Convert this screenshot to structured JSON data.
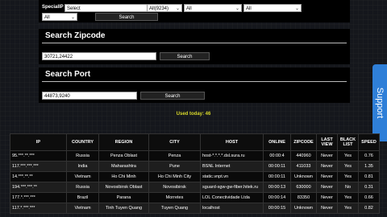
{
  "filters": {
    "specialip_label": "SpecialIP",
    "select_value": "Select",
    "all_count_value": "All(9234)",
    "all_3": "All",
    "all_4": "All",
    "all_row2": "All",
    "search_label": "Search"
  },
  "zipcode": {
    "title": "Search Zipcode",
    "value": "30721,24422",
    "search_label": "Search"
  },
  "port": {
    "title": "Search Port",
    "value": "44873,9240",
    "search_label": "Search"
  },
  "used_today": "Used today: 46",
  "support_label": "Support",
  "table": {
    "headers": [
      "IP",
      "COUNTRY",
      "REGION",
      "CITY",
      "HOST",
      "ONLINE",
      "ZIPCODE",
      "LAST VIEW",
      "BLACK LIST",
      "SPEED"
    ],
    "rows": [
      [
        "95.***.**.***",
        "Russia",
        "Penza Oblast",
        "Penza",
        "host-*.*.*.*.dsl.sura.ru",
        "00:00:4",
        "440960",
        "Never",
        "Yes",
        "0.76"
      ],
      [
        "117.***.***.***",
        "India",
        "Maharashtra",
        "Pune",
        "BSNL Internet",
        "00:00:11",
        "411033",
        "Never",
        "Yes",
        "1.35"
      ],
      [
        "14.***.**.**",
        "Vietnam",
        "Ho Chi Minh",
        "Ho Chi Minh City",
        "static.vnpt.vn",
        "00:00:11",
        "Unknown",
        "Never",
        "Yes",
        "0.81"
      ],
      [
        "194.***.***.**",
        "Russia",
        "Novosibirsk Oblast",
        "Novosibirsk",
        "sguard-sgw-gw-fiber.hitek.ru",
        "00:00:13",
        "630000",
        "Never",
        "No",
        "0.31"
      ],
      [
        "177.*.***.***",
        "Brazil",
        "Parana",
        "Morretes",
        "LOL Conectividade Ltda",
        "00:00:14",
        "83350",
        "Never",
        "Yes",
        "0.66"
      ],
      [
        "117.*.***.***",
        "Vietnam",
        "Tinh Tuyen Quang",
        "Tuyen Quang",
        "localhost",
        "00:00:15",
        "Unknown",
        "Never",
        "Yes",
        "0.82"
      ]
    ]
  }
}
